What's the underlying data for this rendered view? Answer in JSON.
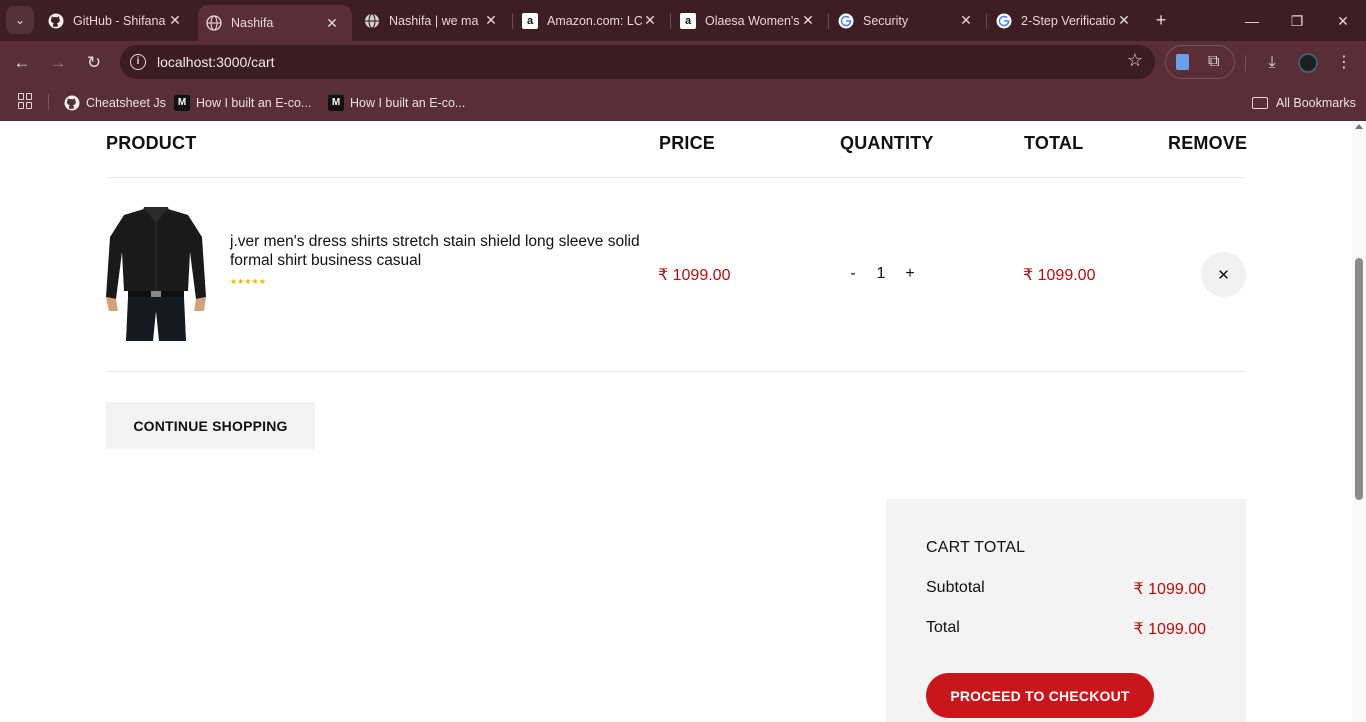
{
  "browser": {
    "tabs": [
      {
        "title": "GitHub - Shifana",
        "icon": "github-icon"
      },
      {
        "title": "Nashifa",
        "icon": "globe-icon",
        "active": true
      },
      {
        "title": "Nashifa | we ma",
        "icon": "globe-icon"
      },
      {
        "title": "Amazon.com: LC",
        "icon": "amazon-icon"
      },
      {
        "title": "Olaesa Women's",
        "icon": "amazon-icon"
      },
      {
        "title": "Security",
        "icon": "google-icon"
      },
      {
        "title": "2-Step Verificatio",
        "icon": "google-icon"
      }
    ],
    "url": "localhost:3000/cart",
    "bookmarks": [
      {
        "label": "Cheatsheet Js",
        "icon": "github-icon"
      },
      {
        "label": "How I built an E-co...",
        "icon": "medium-icon"
      },
      {
        "label": "How I built an E-co...",
        "icon": "medium-icon"
      }
    ],
    "all_bookmarks_label": "All Bookmarks"
  },
  "cart": {
    "headers": {
      "product": "PRODUCT",
      "price": "PRICE",
      "quantity": "QUANTITY",
      "total": "TOTAL",
      "remove": "REMOVE"
    },
    "items": [
      {
        "name": "j.ver men's dress shirts stretch stain shield long sleeve solid formal shirt business casual",
        "stars": "★★★★★",
        "price": "₹ 1099.00",
        "quantity": "1",
        "total": "₹ 1099.00",
        "qty_minus": "-",
        "qty_plus": "+",
        "remove_symbol": "✕"
      }
    ],
    "continue_label": "CONTINUE SHOPPING"
  },
  "summary": {
    "title": "CART TOTAL",
    "subtotal_label": "Subtotal",
    "subtotal_value": "₹ 1099.00",
    "total_label": "Total",
    "total_value": "₹ 1099.00",
    "checkout_label": "PROCEED TO CHECKOUT"
  },
  "colors": {
    "accent": "#c8161c",
    "price": "#b70e0e",
    "chrome_dark": "#3c1e24",
    "chrome": "#5a2e37"
  }
}
